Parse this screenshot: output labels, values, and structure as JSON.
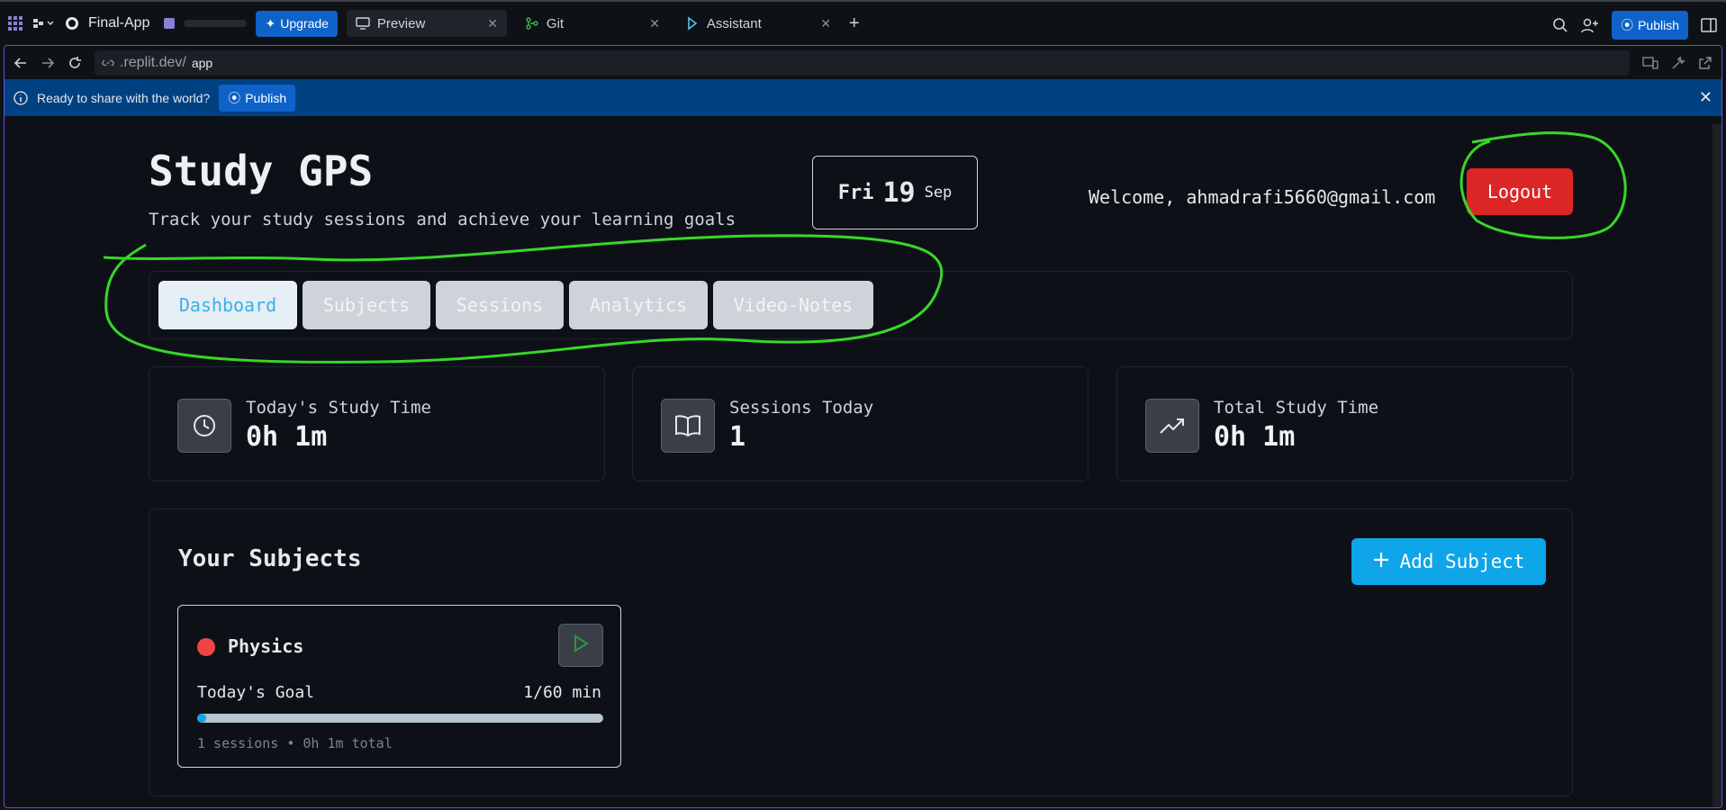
{
  "topbar": {
    "app_name": "Final-App",
    "upgrade_label": "Upgrade",
    "tabs": [
      {
        "label": "Preview",
        "icon": "monitor-icon"
      },
      {
        "label": "Git",
        "icon": "git-icon"
      },
      {
        "label": "Assistant",
        "icon": "assistant-icon"
      }
    ],
    "publish_label": "Publish"
  },
  "urlbar": {
    "domain": ".replit.dev/",
    "path": "app"
  },
  "banner": {
    "message": "Ready to share with the world?",
    "publish_label": "Publish"
  },
  "header": {
    "title": "Study GPS",
    "subtitle": "Track your study sessions and achieve your learning goals",
    "date": {
      "weekday": "Fri",
      "day": "19",
      "month": "Sep"
    },
    "welcome": "Welcome, ahmadrafi5660@gmail.com",
    "logout_label": "Logout"
  },
  "nav": {
    "items": [
      "Dashboard",
      "Subjects",
      "Sessions",
      "Analytics",
      "Video-Notes"
    ],
    "active": "Dashboard"
  },
  "stats": [
    {
      "label": "Today's Study Time",
      "value": "0h 1m",
      "icon": "clock-icon"
    },
    {
      "label": "Sessions Today",
      "value": "1",
      "icon": "book-icon"
    },
    {
      "label": "Total Study Time",
      "value": "0h 1m",
      "icon": "trending-up-icon"
    }
  ],
  "subjects": {
    "title": "Your Subjects",
    "add_label": "Add Subject",
    "items": [
      {
        "name": "Physics",
        "color": "#ef4444",
        "goal_label": "Today's Goal",
        "goal_value": "1/60 min",
        "progress": 0.0167,
        "meta": "1 sessions • 0h 1m total"
      }
    ]
  },
  "colors": {
    "accent": "#0f62c8",
    "logout": "#dc2626",
    "add_button": "#0ea5e9",
    "annotation": "#39d62a"
  }
}
